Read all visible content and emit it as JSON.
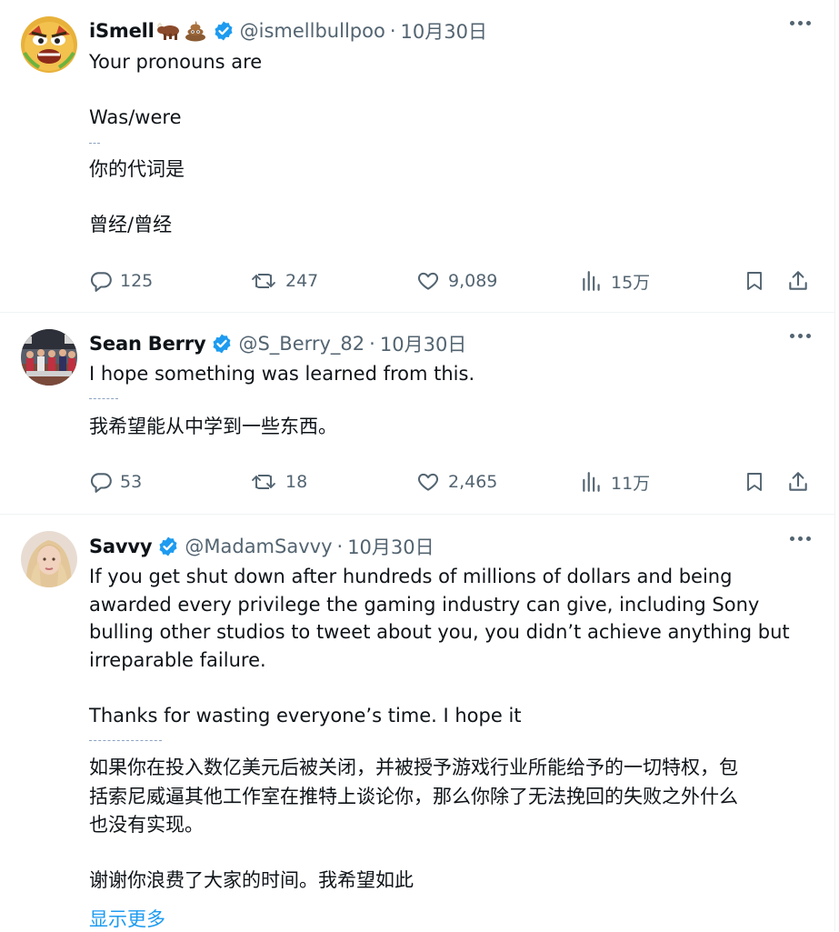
{
  "tweets": [
    {
      "name": "iSmell",
      "handle": "@ismellbullpoo",
      "date": "10月30日",
      "lines": [
        "Your pronouns are",
        "Was/were",
        "你的代词是",
        "曾经/曾经"
      ],
      "stats": {
        "replies": "125",
        "retweets": "247",
        "likes": "9,089",
        "views": "15万"
      }
    },
    {
      "name": "Sean Berry",
      "handle": "@S_Berry_82",
      "date": "10月30日",
      "lines": [
        "I hope something was learned from this.",
        "我希望能从中学到一些东西。"
      ],
      "stats": {
        "replies": "53",
        "retweets": "18",
        "likes": "2,465",
        "views": "11万"
      }
    },
    {
      "name": "Savvy",
      "handle": "@MadamSavvy",
      "date": "10月30日",
      "lines": [
        "If you get shut down after hundreds of millions of dollars and being",
        "awarded every privilege the gaming industry can give, including Sony",
        "bulling other studios to tweet about you, you didn’t achieve anything but",
        "irreparable failure.",
        "Thanks for wasting everyone’s time. I hope it",
        "如果你在投入数亿美元后被关闭，并被授予游戏行业所能给予的一切特权，包",
        "括索尼威逼其他工作室在推特上谈论你，那么你除了无法挽回的失败之外什么",
        "也没有实现。",
        "谢谢你浪费了大家的时间。我希望如此"
      ],
      "show_more": "显示更多"
    }
  ],
  "colors": {
    "accent": "#1d9bf0",
    "muted": "#536471",
    "text": "#0f1419",
    "divider": "#eff3f4"
  }
}
